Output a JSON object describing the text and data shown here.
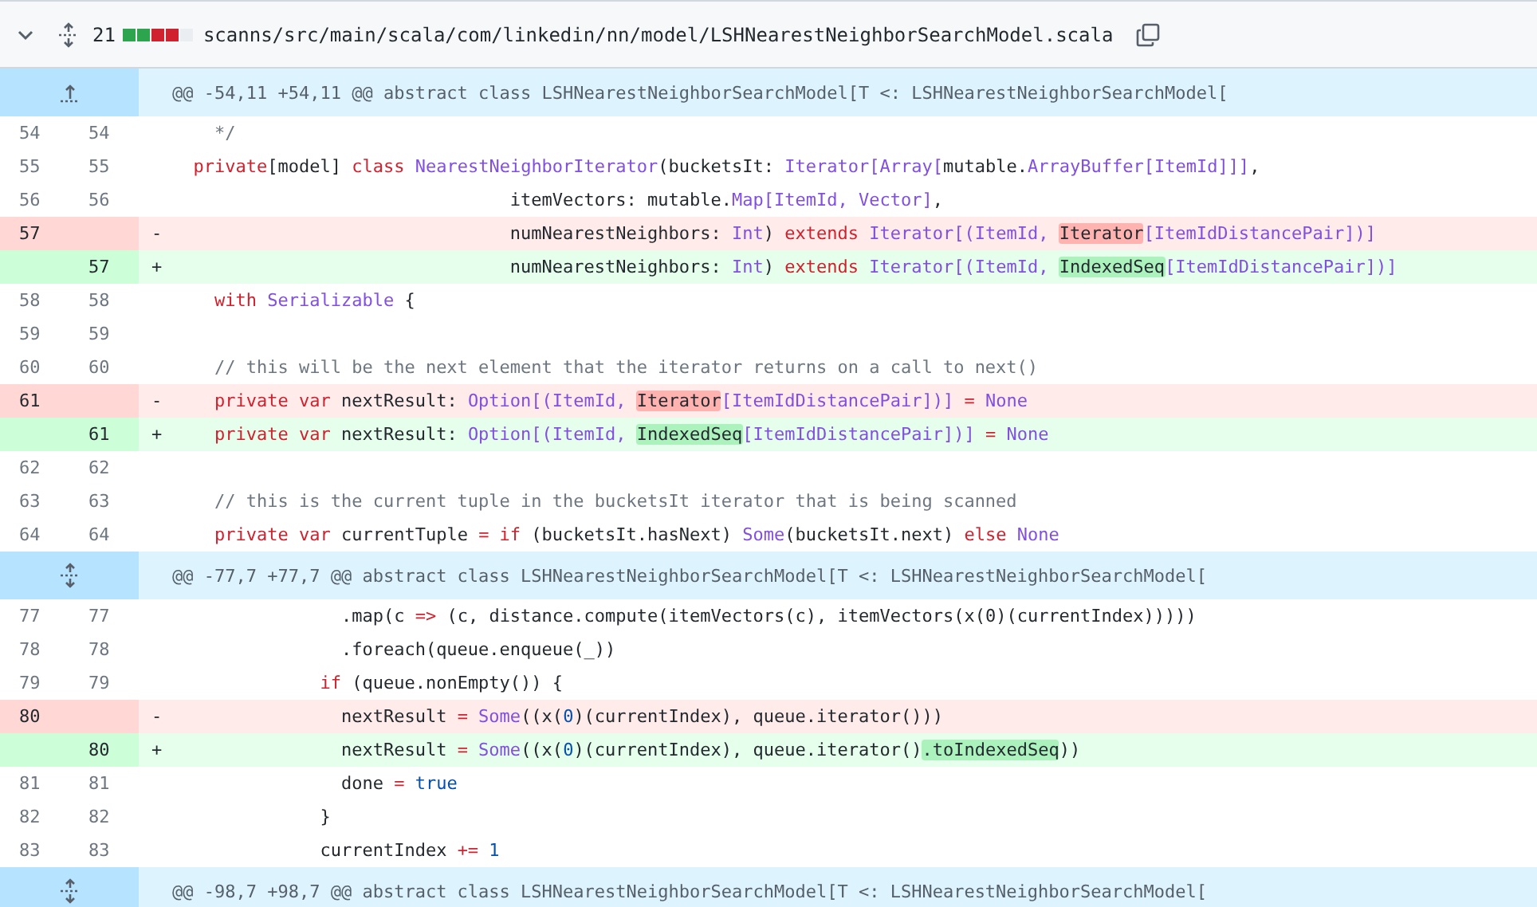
{
  "file_header": {
    "expanded": true,
    "changes": "21",
    "diffstat": [
      {
        "color": "#2da44e"
      },
      {
        "color": "#2da44e"
      },
      {
        "color": "#cf222e"
      },
      {
        "color": "#cf222e"
      },
      {
        "color": "#eaeef2"
      }
    ],
    "path": "scanns/src/main/scala/com/linkedin/nn/model/LSHNearestNeighborSearchModel.scala"
  },
  "rows": [
    {
      "kind": "hunk",
      "text": "@@ -54,11 +54,11 @@ abstract class LSHNearestNeighborSearchModel[T <: LSHNearestNeighborSearchModel["
    },
    {
      "kind": "context",
      "old": "54",
      "new": "54",
      "code": [
        {
          "kind": "comment",
          "text": "    */"
        }
      ]
    },
    {
      "kind": "context",
      "old": "55",
      "new": "55",
      "code": [
        {
          "kind": "keyword",
          "text": "  private"
        },
        {
          "kind": "plain",
          "text": "[model] "
        },
        {
          "kind": "keyword",
          "text": "class"
        },
        {
          "kind": "type",
          "text": " NearestNeighborIterator"
        },
        {
          "kind": "plain",
          "text": "(bucketsIt: "
        },
        {
          "kind": "type",
          "text": "Iterator[Array["
        },
        {
          "kind": "plain",
          "text": "mutable."
        },
        {
          "kind": "type",
          "text": "ArrayBuffer[ItemId]]]"
        },
        {
          "kind": "plain",
          "text": ","
        }
      ]
    },
    {
      "kind": "context",
      "old": "56",
      "new": "56",
      "code": [
        {
          "kind": "plain",
          "text": "                                itemVectors: mutable."
        },
        {
          "kind": "type",
          "text": "Map[ItemId, Vector]"
        },
        {
          "kind": "plain",
          "text": ","
        }
      ]
    },
    {
      "kind": "del",
      "old": "57",
      "sign": "-",
      "code": [
        {
          "kind": "plain",
          "text": "                                numNearestNeighbors: "
        },
        {
          "kind": "type",
          "text": "Int"
        },
        {
          "kind": "plain",
          "text": ") "
        },
        {
          "kind": "keyword",
          "text": "extends"
        },
        {
          "kind": "type",
          "text": " Iterator[(ItemId, "
        },
        {
          "kind": "changed",
          "text": "Iterator"
        },
        {
          "kind": "type",
          "text": "[ItemIdDistancePair])]"
        }
      ]
    },
    {
      "kind": "add",
      "new": "57",
      "sign": "+",
      "code": [
        {
          "kind": "plain",
          "text": "                                numNearestNeighbors: "
        },
        {
          "kind": "type",
          "text": "Int"
        },
        {
          "kind": "plain",
          "text": ") "
        },
        {
          "kind": "keyword",
          "text": "extends"
        },
        {
          "kind": "type",
          "text": " Iterator[(ItemId, "
        },
        {
          "kind": "changed",
          "text": "IndexedSeq"
        },
        {
          "kind": "type",
          "text": "[ItemIdDistancePair])]"
        }
      ]
    },
    {
      "kind": "context",
      "old": "58",
      "new": "58",
      "code": [
        {
          "kind": "keyword",
          "text": "    with"
        },
        {
          "kind": "type",
          "text": " Serializable"
        },
        {
          "kind": "plain",
          "text": " {"
        }
      ]
    },
    {
      "kind": "context",
      "old": "59",
      "new": "59"
    },
    {
      "kind": "context",
      "old": "60",
      "new": "60",
      "code": [
        {
          "kind": "comment",
          "text": "    // this will be the next element that the iterator returns on a call to next()"
        }
      ]
    },
    {
      "kind": "del",
      "old": "61",
      "sign": "-",
      "code": [
        {
          "kind": "keyword",
          "text": "    private var"
        },
        {
          "kind": "plain",
          "text": " nextResult: "
        },
        {
          "kind": "type",
          "text": "Option[(ItemId, "
        },
        {
          "kind": "changed",
          "text": "Iterator"
        },
        {
          "kind": "type",
          "text": "[ItemIdDistancePair])]"
        },
        {
          "kind": "keyword",
          "text": " ="
        },
        {
          "kind": "type",
          "text": " None"
        }
      ]
    },
    {
      "kind": "add",
      "new": "61",
      "sign": "+",
      "code": [
        {
          "kind": "keyword",
          "text": "    private var"
        },
        {
          "kind": "plain",
          "text": " nextResult: "
        },
        {
          "kind": "type",
          "text": "Option[(ItemId, "
        },
        {
          "kind": "changed",
          "text": "IndexedSeq"
        },
        {
          "kind": "type",
          "text": "[ItemIdDistancePair])]"
        },
        {
          "kind": "keyword",
          "text": " ="
        },
        {
          "kind": "type",
          "text": " None"
        }
      ]
    },
    {
      "kind": "context",
      "old": "62",
      "new": "62"
    },
    {
      "kind": "context",
      "old": "63",
      "new": "63",
      "code": [
        {
          "kind": "comment",
          "text": "    // this is the current tuple in the bucketsIt iterator that is being scanned"
        }
      ]
    },
    {
      "kind": "context",
      "old": "64",
      "new": "64",
      "code": [
        {
          "kind": "keyword",
          "text": "    private var"
        },
        {
          "kind": "plain",
          "text": " currentTuple "
        },
        {
          "kind": "keyword",
          "text": "= if"
        },
        {
          "kind": "plain",
          "text": " (bucketsIt.hasNext) "
        },
        {
          "kind": "type",
          "text": "Some"
        },
        {
          "kind": "plain",
          "text": "(bucketsIt.next) "
        },
        {
          "kind": "keyword",
          "text": "else"
        },
        {
          "kind": "type",
          "text": " None"
        }
      ]
    },
    {
      "kind": "hunk",
      "text": "@@ -77,7 +77,7 @@ abstract class LSHNearestNeighborSearchModel[T <: LSHNearestNeighborSearchModel["
    },
    {
      "kind": "context",
      "old": "77",
      "new": "77",
      "code": [
        {
          "kind": "plain",
          "text": "                .map(c "
        },
        {
          "kind": "keyword",
          "text": "=>"
        },
        {
          "kind": "plain",
          "text": " (c, distance.compute(itemVectors(c), itemVectors(x(0)(currentIndex)))))"
        }
      ]
    },
    {
      "kind": "context",
      "old": "78",
      "new": "78",
      "code": [
        {
          "kind": "plain",
          "text": "                .foreach(queue.enqueue(_))"
        }
      ]
    },
    {
      "kind": "context",
      "old": "79",
      "new": "79",
      "code": [
        {
          "kind": "keyword",
          "text": "              if"
        },
        {
          "kind": "plain",
          "text": " (queue.nonEmpty()) {"
        }
      ]
    },
    {
      "kind": "del",
      "old": "80",
      "sign": "-",
      "code": [
        {
          "kind": "plain",
          "text": "                nextResult "
        },
        {
          "kind": "keyword",
          "text": "="
        },
        {
          "kind": "type",
          "text": " Some"
        },
        {
          "kind": "plain",
          "text": "((x("
        },
        {
          "kind": "number",
          "text": "0"
        },
        {
          "kind": "plain",
          "text": ")(currentIndex), queue.iterator()))"
        }
      ]
    },
    {
      "kind": "add",
      "new": "80",
      "sign": "+",
      "code": [
        {
          "kind": "plain",
          "text": "                nextResult "
        },
        {
          "kind": "keyword",
          "text": "="
        },
        {
          "kind": "type",
          "text": " Some"
        },
        {
          "kind": "plain",
          "text": "((x("
        },
        {
          "kind": "number",
          "text": "0"
        },
        {
          "kind": "plain",
          "text": ")(currentIndex), queue.iterator()"
        },
        {
          "kind": "changed",
          "text": ".toIndexedSeq"
        },
        {
          "kind": "plain",
          "text": "))"
        }
      ]
    },
    {
      "kind": "context",
      "old": "81",
      "new": "81",
      "code": [
        {
          "kind": "plain",
          "text": "                done "
        },
        {
          "kind": "keyword",
          "text": "="
        },
        {
          "kind": "number",
          "text": " true"
        }
      ]
    },
    {
      "kind": "context",
      "old": "82",
      "new": "82",
      "code": [
        {
          "kind": "plain",
          "text": "              }"
        }
      ]
    },
    {
      "kind": "context",
      "old": "83",
      "new": "83",
      "code": [
        {
          "kind": "plain",
          "text": "              currentIndex "
        },
        {
          "kind": "keyword",
          "text": "+="
        },
        {
          "kind": "number",
          "text": " 1"
        }
      ]
    },
    {
      "kind": "hunk",
      "text": "@@ -98,7 +98,7 @@ abstract class LSHNearestNeighborSearchModel[T <: LSHNearestNeighborSearchModel["
    }
  ]
}
